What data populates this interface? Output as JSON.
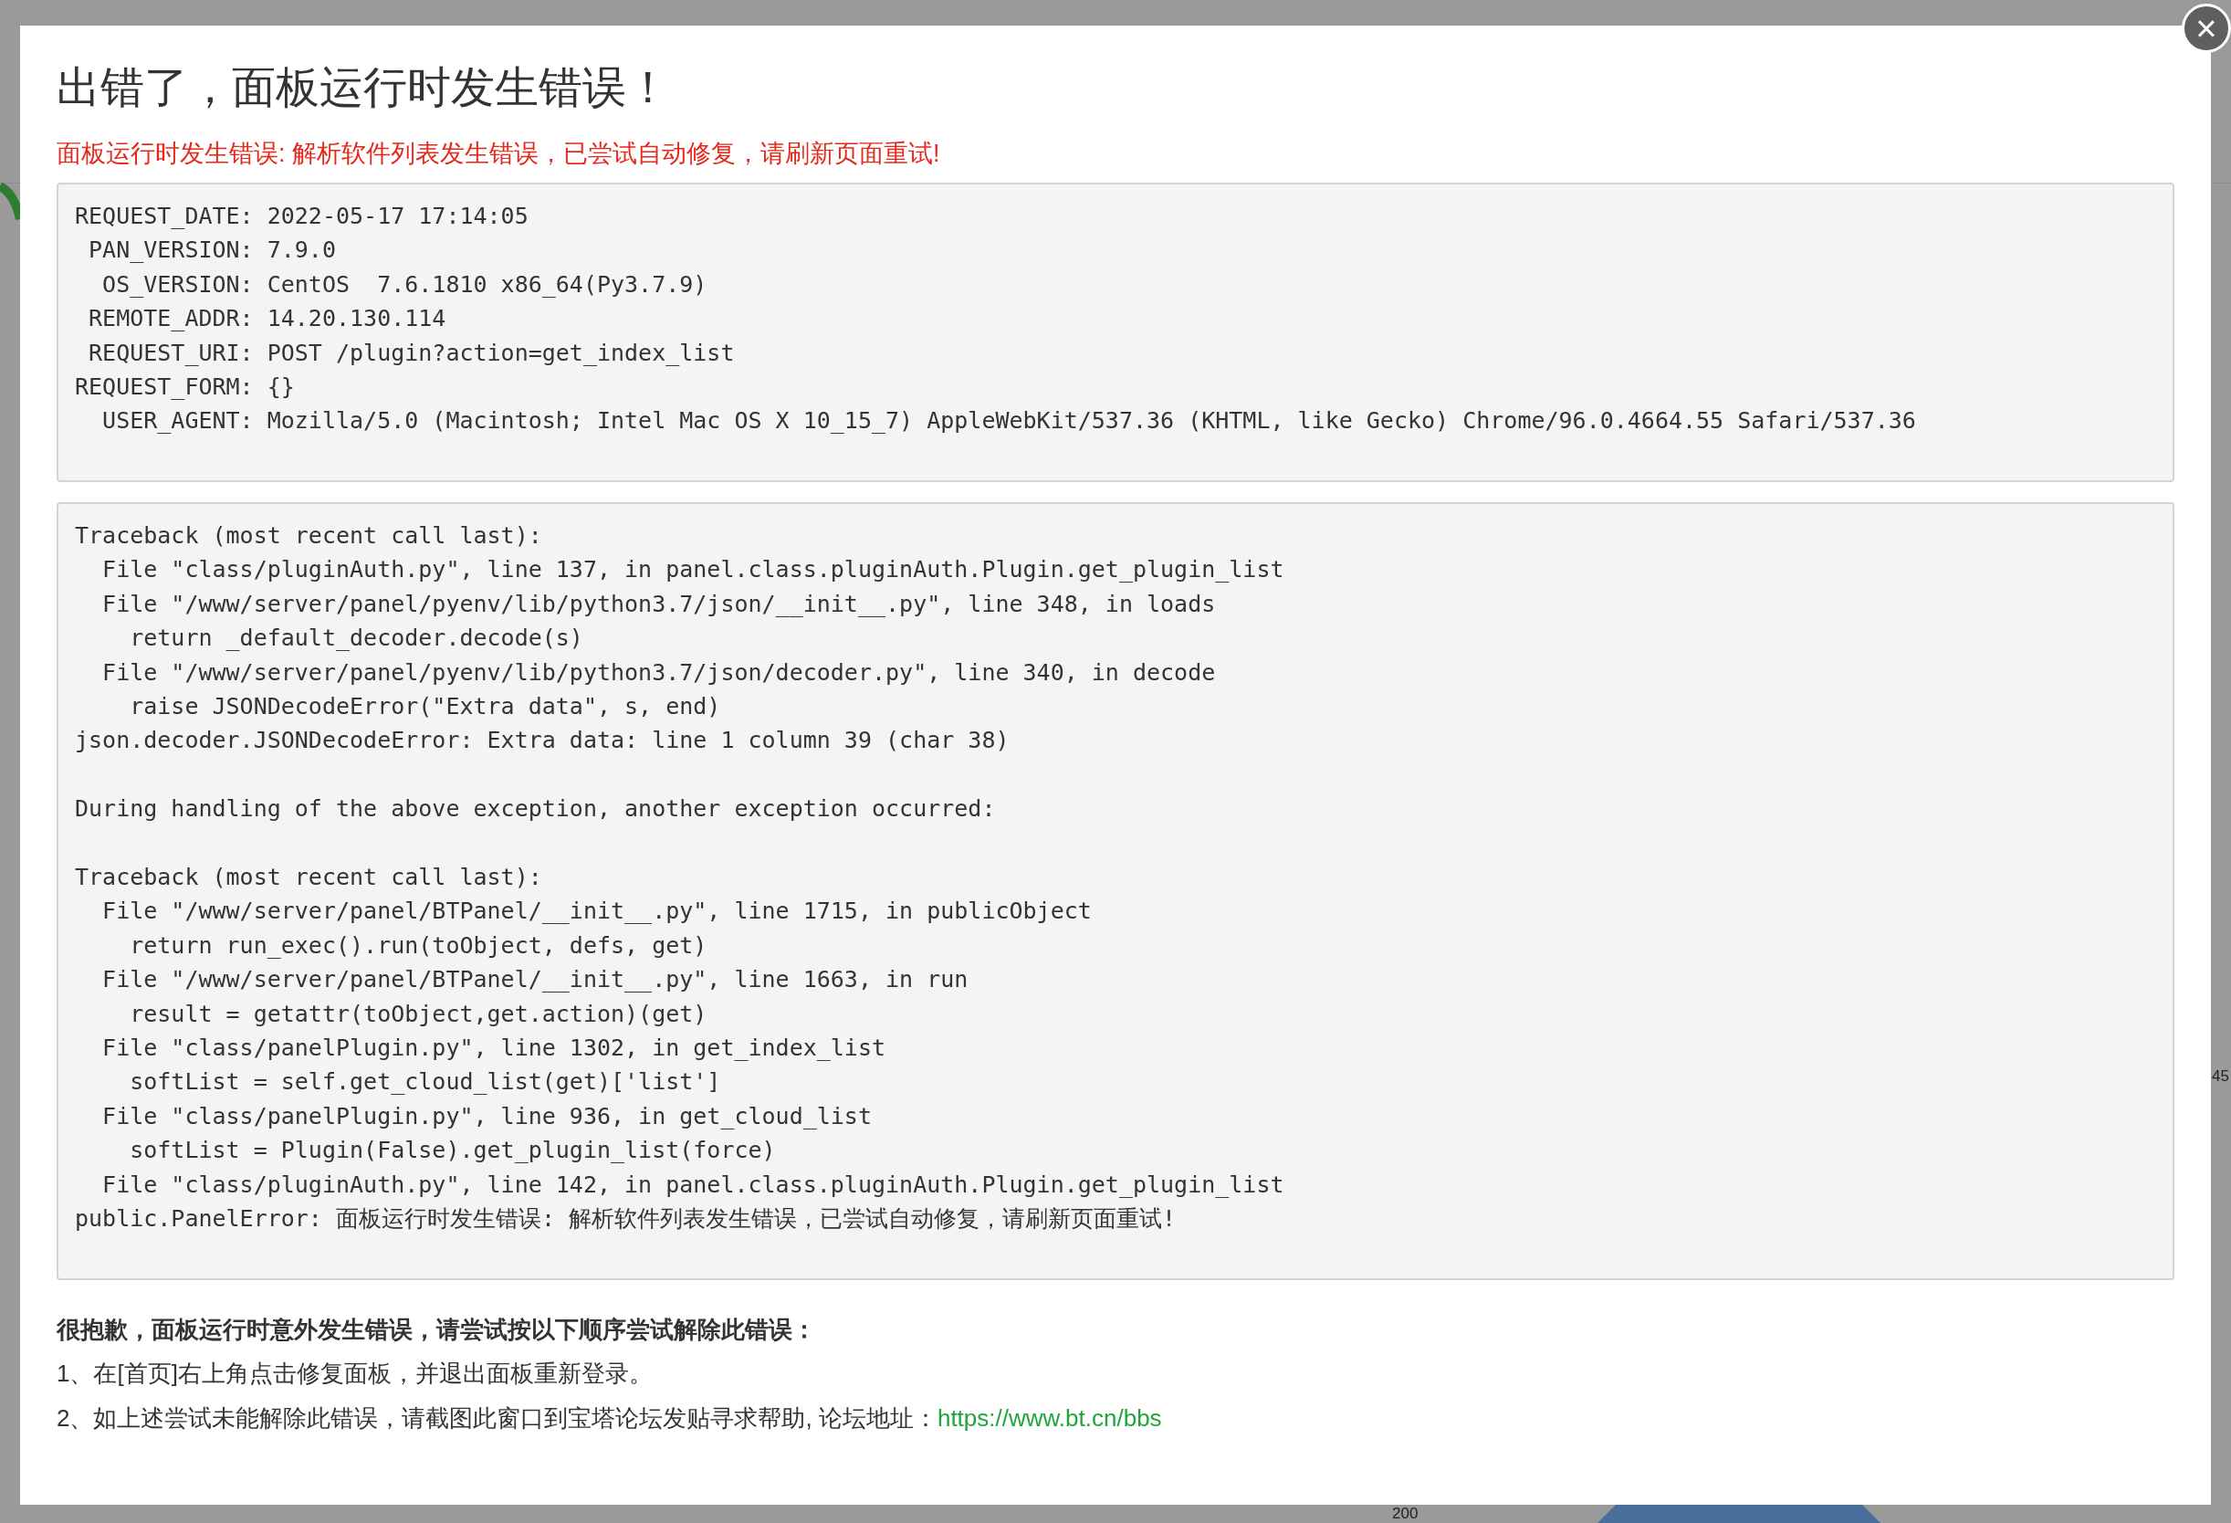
{
  "background": {
    "fragments": [
      {
        "kind": "axis-label",
        "text": "45"
      },
      {
        "kind": "axis-label",
        "text": "200"
      }
    ]
  },
  "dialog": {
    "title": "出错了，面板运行时发生错误！",
    "error_message": "面板运行时发生错误: 解析软件列表发生错误，已尝试自动修复，请刷新页面重试!",
    "request_info": [
      [
        "REQUEST_DATE: 2022-05-17 17:14:05",
        " PAN_VERSION: 7.9.0",
        "  OS_VERSION: CentOS  7.6.1810 x86_64(Py3.7.9)",
        " REMOTE_ADDR: 14.20.130.114",
        " REQUEST_URI: POST /plugin?action=get_index_list",
        "REQUEST_FORM: {}",
        "  USER_AGENT: Mozilla/5.0 (Macintosh; Intel Mac OS X 10_15_7) AppleWebKit/537.36 (KHTML, like Gecko) Chrome/96.0.4664.55 Safari/537.36"
      ]
    ],
    "traceback": [
      [
        "Traceback (most recent call last):",
        "  File \"class/pluginAuth.py\", line 137, in panel.class.pluginAuth.Plugin.get_plugin_list",
        "  File \"/www/server/panel/pyenv/lib/python3.7/json/__init__.py\", line 348, in loads",
        "    return _default_decoder.decode(s)",
        "  File \"/www/server/panel/pyenv/lib/python3.7/json/decoder.py\", line 340, in decode",
        "    raise JSONDecodeError(\"Extra data\", s, end)",
        "json.decoder.JSONDecodeError: Extra data: line 1 column 39 (char 38)"
      ],
      [
        "During handling of the above exception, another exception occurred:"
      ],
      [
        "Traceback (most recent call last):",
        "  File \"/www/server/panel/BTPanel/__init__.py\", line 1715, in publicObject",
        "    return run_exec().run(toObject, defs, get)",
        "  File \"/www/server/panel/BTPanel/__init__.py\", line 1663, in run",
        "    result = getattr(toObject,get.action)(get)",
        "  File \"class/panelPlugin.py\", line 1302, in get_index_list",
        "    softList = self.get_cloud_list(get)['list']",
        "  File \"class/panelPlugin.py\", line 936, in get_cloud_list",
        "    softList = Plugin(False).get_plugin_list(force)",
        "  File \"class/pluginAuth.py\", line 142, in panel.class.pluginAuth.Plugin.get_plugin_list",
        "public.PanelError: 面板运行时发生错误: 解析软件列表发生错误，已尝试自动修复，请刷新页面重试!"
      ]
    ],
    "help_heading": "很抱歉，面板运行时意外发生错误，请尝试按以下顺序尝试解除此错误：",
    "help_steps": [
      {
        "text": "1、在[首页]右上角点击修复面板，并退出面板重新登录。"
      },
      {
        "text": "2、如上述尝试未能解除此错误，请截图此窗口到宝塔论坛发贴寻求帮助, 论坛地址：",
        "link": "https://www.bt.cn/bbs"
      }
    ],
    "close_button": "×"
  }
}
